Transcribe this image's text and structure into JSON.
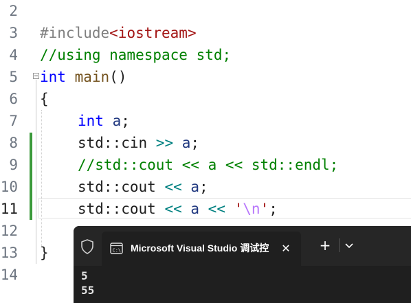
{
  "editor": {
    "lines": [
      {
        "num": "2"
      },
      {
        "num": "3",
        "directive": "#include",
        "header": "<iostream>"
      },
      {
        "num": "4",
        "comment": "//using namespace std;"
      },
      {
        "num": "5",
        "type": "int",
        "name": "main",
        "parens": "()"
      },
      {
        "num": "6",
        "text": "{"
      },
      {
        "num": "7",
        "type": "int",
        "var": "a",
        "semi": ";"
      },
      {
        "num": "8",
        "ns": "std::cin ",
        "op": ">>",
        "var": " a",
        "semi": ";"
      },
      {
        "num": "9",
        "comment": "//std::cout << a << std::endl;"
      },
      {
        "num": "10",
        "ns": "std::cout ",
        "op": "<<",
        "var": " a",
        "semi": ";"
      },
      {
        "num": "11",
        "ns": "std::cout ",
        "op1": "<<",
        "var": " a ",
        "op2": "<<",
        "q1": " '",
        "esc": "\\n",
        "q2": "'",
        "semi": ";"
      },
      {
        "num": "12"
      },
      {
        "num": "13",
        "text": "}"
      },
      {
        "num": "14"
      }
    ]
  },
  "terminal": {
    "tab_title": "Microsoft Visual Studio 调试控",
    "close_glyph": "✕",
    "new_tab_glyph": "+",
    "output": [
      "5",
      "55"
    ]
  },
  "icons": {
    "shield": "shield-icon",
    "console": "console-icon",
    "close": "close-icon",
    "add": "plus-icon",
    "dropdown": "chevron-down-icon"
  },
  "colors": {
    "keyword": "#0000ff",
    "comment": "#008000",
    "string": "#a31515",
    "change_bar": "#3a9a3a",
    "terminal_bg": "#1f1f1f"
  }
}
